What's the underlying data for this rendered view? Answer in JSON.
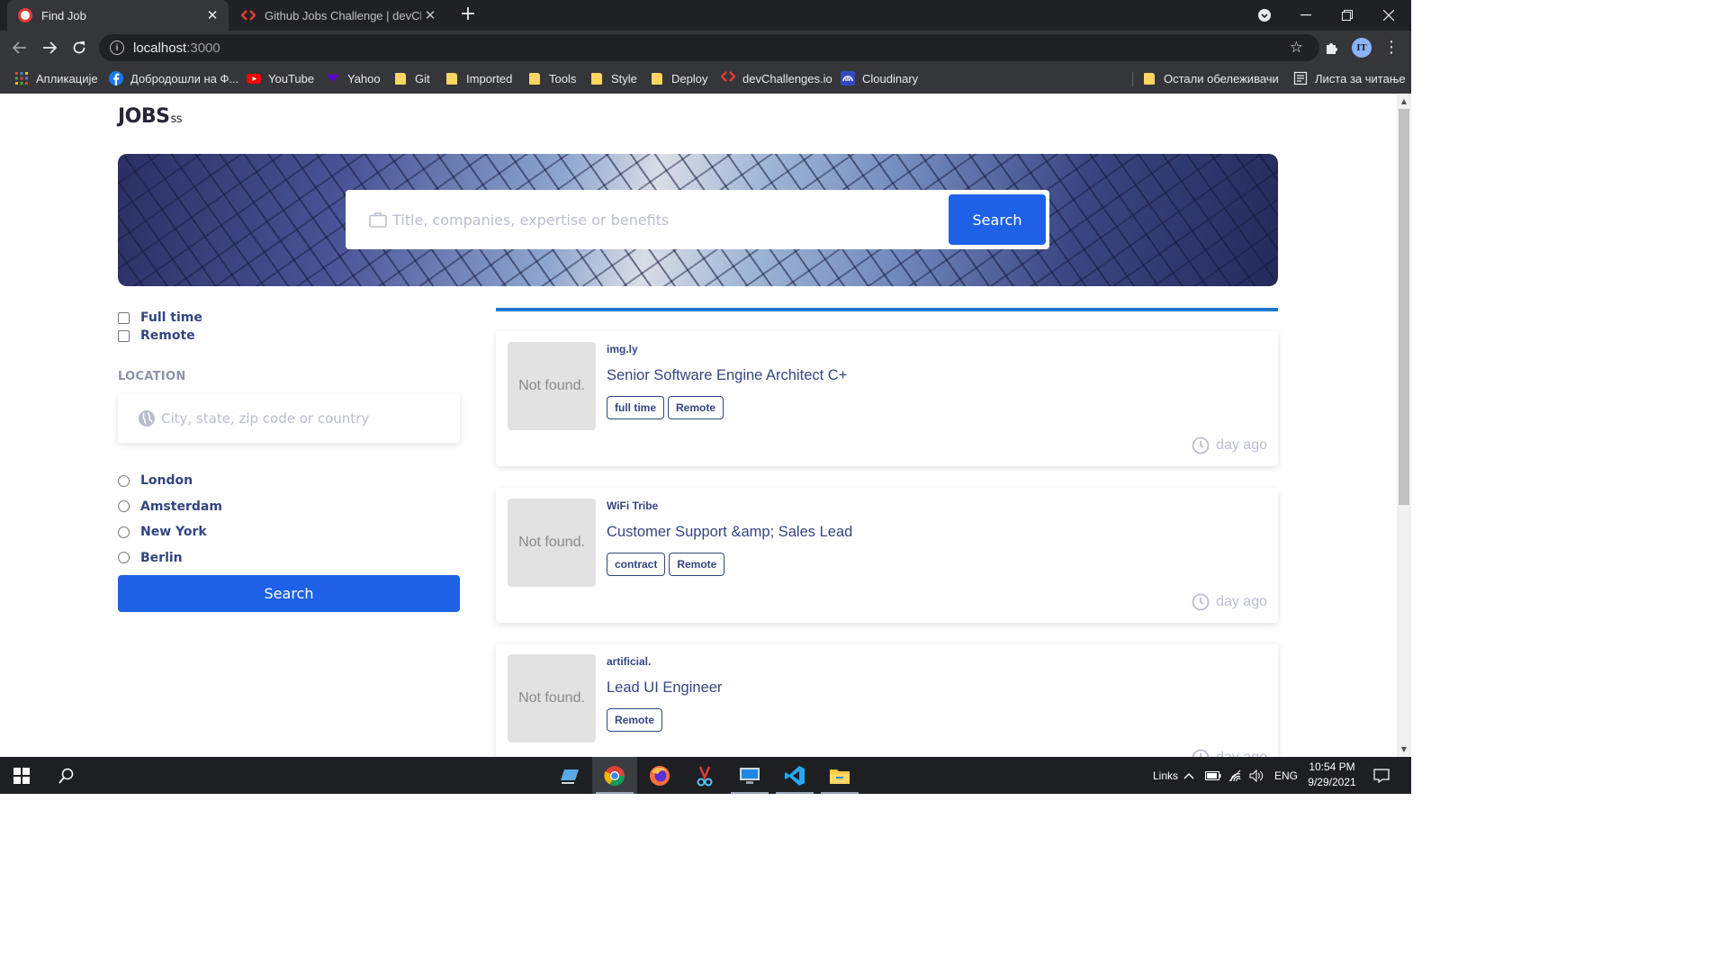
{
  "browser": {
    "tabs": [
      {
        "title": "Find Job",
        "active": true
      },
      {
        "title": "Github Jobs Challenge | devChallenges",
        "active": false
      }
    ],
    "new_tab_label": "+",
    "url_host": "localhost",
    "url_port": ":3000",
    "profile_initials": "IT",
    "bookmarks": [
      {
        "label": "Апликације",
        "icon": "apps-icon"
      },
      {
        "label": "Добродошли на Ф...",
        "icon": "facebook-icon"
      },
      {
        "label": "YouTube",
        "icon": "youtube-icon"
      },
      {
        "label": "Yahoo",
        "icon": "yahoo-icon"
      },
      {
        "label": "Git",
        "icon": "folder-icon"
      },
      {
        "label": "Imported",
        "icon": "folder-icon"
      },
      {
        "label": "Tools",
        "icon": "folder-icon"
      },
      {
        "label": "Style",
        "icon": "folder-icon"
      },
      {
        "label": "Deploy",
        "icon": "folder-icon"
      },
      {
        "label": "devChallenges.io",
        "icon": "devchallenges-icon"
      },
      {
        "label": "Cloudinary",
        "icon": "cloudinary-icon"
      }
    ],
    "other_bookmarks": "Остали обележивачи",
    "reading_list": "Листа за читање"
  },
  "app": {
    "logo": "JOBS",
    "logo_suffix": "ss",
    "hero_search": {
      "placeholder": "Title, companies, expertise or benefits",
      "button": "Search"
    },
    "filters": {
      "checkboxes": [
        "Full time",
        "Remote"
      ],
      "location_title": "LOCATION",
      "location_placeholder": "City, state, zip code or country",
      "cities": [
        "London",
        "Amsterdam",
        "New York",
        "Berlin"
      ],
      "button": "Search"
    },
    "jobs": [
      {
        "logo_text": "Not found.",
        "company": "img.ly",
        "title": "Senior Software Engine Architect C+",
        "tags": [
          "full time",
          "Remote"
        ],
        "posted": "day ago"
      },
      {
        "logo_text": "Not found.",
        "company": "WiFi Tribe",
        "title": "Customer Support &amp; Sales Lead",
        "tags": [
          "contract",
          "Remote"
        ],
        "posted": "day ago"
      },
      {
        "logo_text": "Not found.",
        "company": "artificial.",
        "title": "Lead UI Engineer",
        "tags": [
          "Remote"
        ],
        "posted": "day ago"
      }
    ]
  },
  "taskbar": {
    "links_label": "Links",
    "language": "ENG",
    "time": "10:54 PM",
    "date": "9/29/2021"
  },
  "colors": {
    "accent": "#1e61e7",
    "text": "#334680",
    "muted": "#b9bdcf",
    "chrome_dark": "#202124",
    "chrome_mid": "#35363a"
  }
}
